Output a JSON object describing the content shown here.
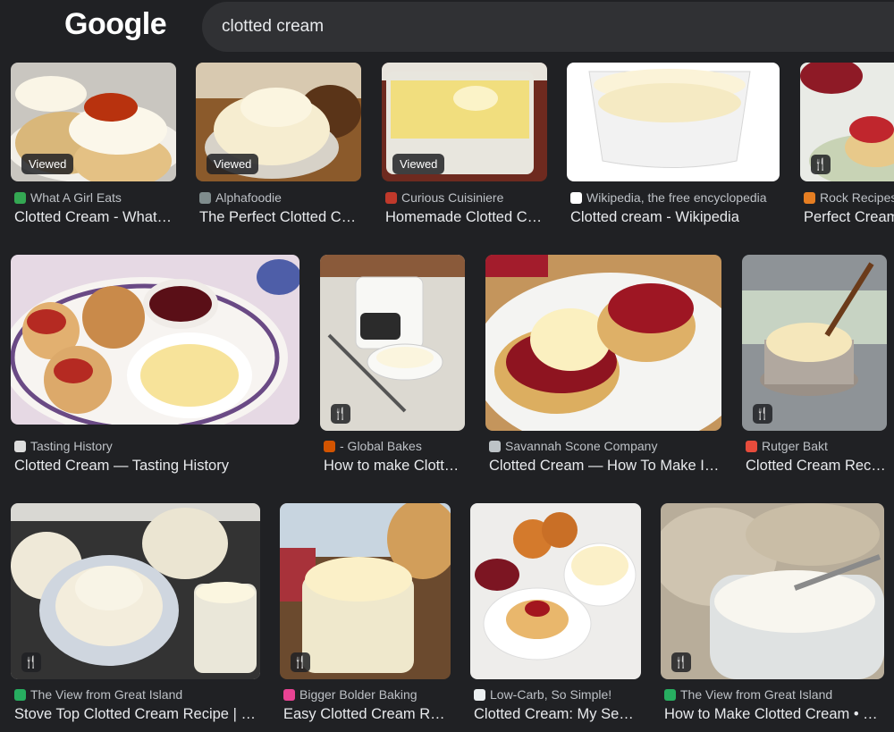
{
  "logo": "Google",
  "search": {
    "query": "clotted cream"
  },
  "badges": {
    "viewed": "Viewed",
    "recipe_icon": "🍴"
  },
  "results": [
    {
      "source": "What A Girl Eats",
      "title": "Clotted Cream - What…",
      "badge": "viewed",
      "favicon_color": "#34a853"
    },
    {
      "source": "Alphafoodie",
      "title": "The Perfect Clotted C…",
      "badge": "viewed",
      "favicon_color": "#7f8c8d"
    },
    {
      "source": "Curious Cuisiniere",
      "title": "Homemade Clotted C…",
      "badge": "viewed",
      "favicon_color": "#c0392b"
    },
    {
      "source": "Wikipedia, the free encyclopedia",
      "title": "Clotted cream - Wikipedia",
      "badge": "",
      "favicon_color": "#ffffff"
    },
    {
      "source": "Rock Recipes",
      "title": "Perfect Cream",
      "badge": "recipe",
      "favicon_color": "#e67e22"
    },
    {
      "source": "Tasting History",
      "title": "Clotted Cream — Tasting History",
      "badge": "",
      "favicon_color": "#dddddd"
    },
    {
      "source": "- Global Bakes",
      "title": "How to make Clott…",
      "badge": "recipe",
      "favicon_color": "#d35400"
    },
    {
      "source": "Savannah Scone Company",
      "title": "Clotted Cream — How To Make I…",
      "badge": "",
      "favicon_color": "#bdc3c7"
    },
    {
      "source": "Rutger Bakt",
      "title": "Clotted Cream Rec…",
      "badge": "recipe",
      "favicon_color": "#e74c3c"
    },
    {
      "source": "The View from Great Island",
      "title": "Stove Top Clotted Cream Recipe | …",
      "badge": "recipe",
      "favicon_color": "#27ae60"
    },
    {
      "source": "Bigger Bolder Baking",
      "title": "Easy Clotted Cream R…",
      "badge": "recipe",
      "favicon_color": "#e84393"
    },
    {
      "source": "Low-Carb, So Simple!",
      "title": "Clotted Cream: My Se…",
      "badge": "",
      "favicon_color": "#ecf0f1"
    },
    {
      "source": "The View from Great Island",
      "title": "How to Make Clotted Cream • …",
      "badge": "recipe",
      "favicon_color": "#27ae60"
    }
  ]
}
